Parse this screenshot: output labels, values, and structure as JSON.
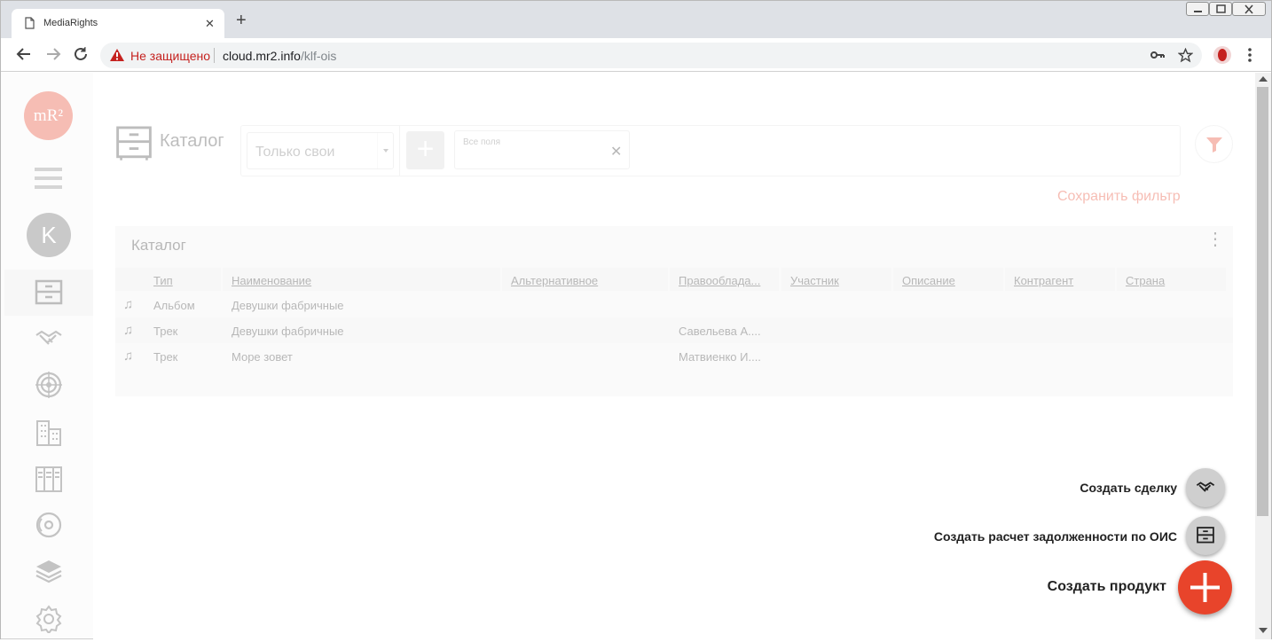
{
  "browser": {
    "tab_title": "MediaRights",
    "security_text": "Не защищено",
    "url_host": "cloud.mr2.info",
    "url_path": "/klf-ois"
  },
  "sidebar": {
    "logo_text": "mR²",
    "avatar_letter": "K",
    "items": [
      "catalog-icon",
      "handshake-icon",
      "target-icon",
      "buildings-icon",
      "cabinet-icon",
      "disc-icon",
      "layers-icon",
      "gear-icon"
    ]
  },
  "page": {
    "title": "Каталог",
    "filter_select": "Только свои",
    "search_placeholder": "Все поля",
    "save_filter": "Сохранить фильтр"
  },
  "table": {
    "title": "Каталог",
    "columns": [
      "Тип",
      "Наименование",
      "Альтернативное",
      "Правообладатель",
      "Участник",
      "Описание",
      "Контрагент",
      "Страна"
    ],
    "columns_display": [
      "Тип",
      "Наименование",
      "Альтернативное",
      "Правооблада...",
      "Участник",
      "Описание",
      "Контрагент",
      "Страна"
    ],
    "rows": [
      {
        "type": "Альбом",
        "name": "Девушки фабричные",
        "owner": ""
      },
      {
        "type": "Трек",
        "name": "Девушки фабричные",
        "owner": "Савельева А...."
      },
      {
        "type": "Трек",
        "name": "Море зовет",
        "owner": "Матвиенко И...."
      }
    ]
  },
  "fab": {
    "create_deal": "Создать сделку",
    "create_debt": "Создать расчет задолженности по ОИС",
    "create_product": "Создать продукт"
  },
  "colors": {
    "accent": "#e8442b",
    "sidebar_bg": "#f8f8f8"
  }
}
